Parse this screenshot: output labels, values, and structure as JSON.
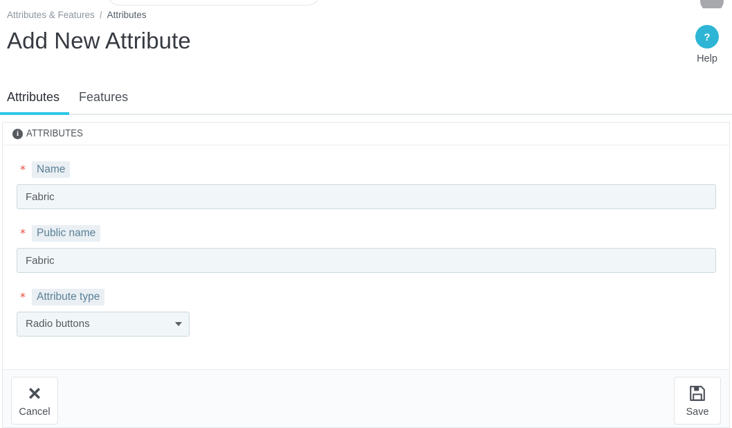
{
  "window": {
    "top_search_placeholder": "",
    "avatar": "user-avatar"
  },
  "breadcrumb": {
    "parent": "Attributes & Features",
    "separator": "/",
    "current": "Attributes"
  },
  "page": {
    "title": "Add New Attribute"
  },
  "help": {
    "label": "Help",
    "icon": "question-mark-icon",
    "color": "#2eb5d6"
  },
  "tabs": [
    {
      "label": "Attributes",
      "active": true
    },
    {
      "label": "Features",
      "active": false
    }
  ],
  "panel": {
    "icon": "info-icon",
    "title": "ATTRIBUTES"
  },
  "form": {
    "fields": [
      {
        "label": "Name",
        "required_marker": "*",
        "value": "Fabric",
        "placeholder": "",
        "type": "text"
      },
      {
        "label": "Public name",
        "required_marker": "*",
        "value": "Fabric",
        "placeholder": "",
        "type": "text"
      },
      {
        "label": "Attribute type",
        "required_marker": "*",
        "value": "Radio buttons",
        "type": "select",
        "options": [
          "Radio buttons"
        ]
      }
    ]
  },
  "footer": {
    "cancel": {
      "label": "Cancel",
      "icon": "close-x-icon"
    },
    "save": {
      "label": "Save",
      "icon": "floppy-disk-icon"
    }
  },
  "colors": {
    "accent": "#2ec6e8",
    "help_circle": "#2eb5d6",
    "required": "#e84c3d",
    "label_chip_bg": "#e9eff3",
    "label_text": "#5b7f97",
    "input_bg": "#f1f6f8",
    "input_border": "#cdd9de"
  }
}
